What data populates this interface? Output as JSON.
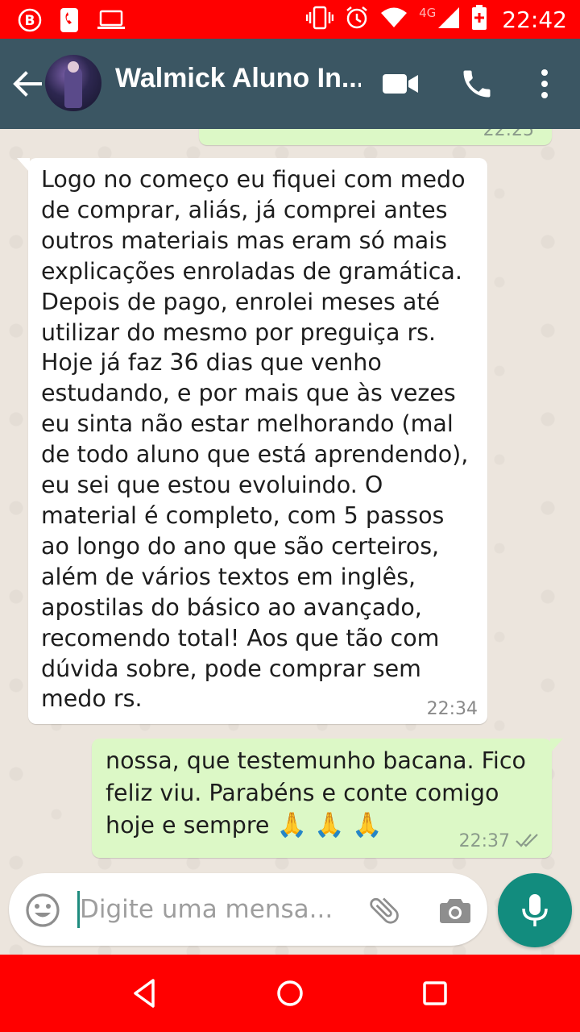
{
  "status_bar": {
    "time": "22:42",
    "network": "4G",
    "icons": [
      "b-badge-icon",
      "phone-notification-icon",
      "laptop-icon",
      "vibrate-icon",
      "alarm-icon",
      "wifi-icon",
      "cell-signal-icon",
      "battery-icon"
    ]
  },
  "header": {
    "contact_name": "Walmick Aluno In...",
    "icons": [
      "back-arrow-icon",
      "video-call-icon",
      "phone-call-icon",
      "more-vert-icon"
    ]
  },
  "messages": {
    "previous": {
      "time": "22:25"
    },
    "incoming": {
      "text": "Logo no começo eu fiquei com medo de comprar, aliás, já comprei antes outros materiais mas eram só mais explicações enroladas de gramática. Depois de pago, enrolei meses até utilizar do mesmo por preguiça rs. Hoje já faz 36 dias que venho estudando, e por mais que às vezes eu sinta não estar melhorando (mal de todo aluno que está aprendendo), eu sei que estou evoluindo. O material é completo, com 5 passos ao longo do ano que são certeiros, além de vários textos em inglês, apostilas do básico ao avançado, recomendo total! Aos que tão com dúvida sobre, pode comprar sem medo rs.",
      "time": "22:34"
    },
    "outgoing": {
      "text": "nossa, que testemunho bacana. Fico feliz viu. Parabéns e conte comigo hoje e sempre",
      "emojis": "🙏 🙏 🙏",
      "time": "22:37",
      "status": "read"
    }
  },
  "composer": {
    "placeholder": "Digite uma mensa...",
    "icons": [
      "emoji-icon",
      "attach-icon",
      "camera-icon",
      "mic-icon"
    ]
  },
  "nav_bar": {
    "icons": [
      "nav-back-icon",
      "nav-home-icon",
      "nav-recents-icon"
    ]
  },
  "colors": {
    "status_bar": "#ff0000",
    "app_bar": "#3b5663",
    "chat_bg": "#ece5dd",
    "outgoing_bubble": "#dcf8c6",
    "incoming_bubble": "#ffffff",
    "mic_button": "#128c7e"
  }
}
